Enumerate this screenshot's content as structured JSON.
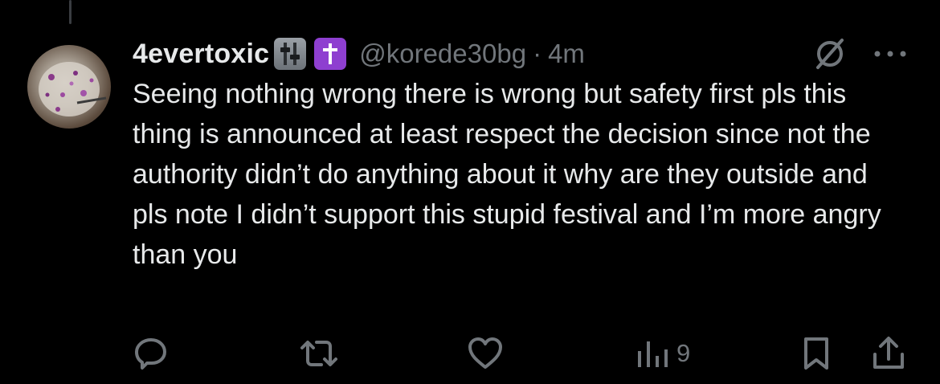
{
  "tweet": {
    "display_name": "4evertoxic",
    "name_emojis": [
      "level-slider-emoji",
      "latin-cross-emoji"
    ],
    "handle": "@korede30bg",
    "separator": "·",
    "time": "4m",
    "text": "Seeing nothing wrong there is wrong but safety first pls this thing is announced at least respect the decision since not the authority didn’t do anything about it why are they outside and pls note I didn’t support this stupid festival and I’m more angry than you"
  },
  "actions": {
    "views_count": "9"
  },
  "icons": {
    "grok": "grok-icon",
    "more": "more-icon",
    "reply": "reply-icon",
    "retweet": "retweet-icon",
    "like": "like-icon",
    "views": "views-icon",
    "bookmark": "bookmark-icon",
    "share": "share-icon"
  },
  "colors": {
    "background": "#000000",
    "text_primary": "#e7e9ea",
    "text_secondary": "#71767b",
    "cross_emoji": "#8e3fd0"
  }
}
